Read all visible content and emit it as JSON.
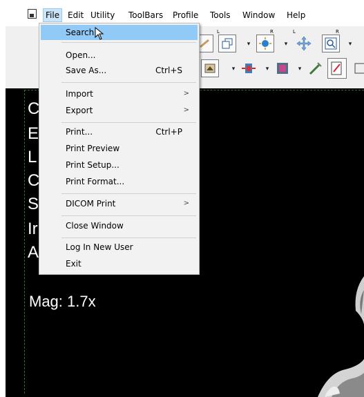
{
  "menubar": {
    "items": [
      {
        "label": "File"
      },
      {
        "label": "Edit"
      },
      {
        "label": "Utility"
      },
      {
        "label": "ToolBars"
      },
      {
        "label": "Profile"
      },
      {
        "label": "Tools"
      },
      {
        "label": "Window"
      },
      {
        "label": "Help"
      }
    ]
  },
  "file_menu": {
    "items": [
      {
        "label": "Search",
        "shortcut": "",
        "submenu": false
      },
      {
        "label": "Open...",
        "shortcut": "",
        "submenu": false
      },
      {
        "label": "Save As...",
        "shortcut": "Ctrl+S",
        "submenu": false
      },
      {
        "label": "Import",
        "shortcut": "",
        "submenu": true
      },
      {
        "label": "Export",
        "shortcut": "",
        "submenu": true
      },
      {
        "label": "Print...",
        "shortcut": "Ctrl+P",
        "submenu": false
      },
      {
        "label": "Print Preview",
        "shortcut": "",
        "submenu": false
      },
      {
        "label": "Print Setup...",
        "shortcut": "",
        "submenu": false
      },
      {
        "label": "Print Format...",
        "shortcut": "",
        "submenu": false
      },
      {
        "label": "DICOM Print",
        "shortcut": "",
        "submenu": true
      },
      {
        "label": "Close Window",
        "shortcut": "",
        "submenu": false
      },
      {
        "label": "Log In New User",
        "shortcut": "",
        "submenu": false
      },
      {
        "label": "Exit",
        "shortcut": "",
        "submenu": false
      }
    ],
    "submenu_arrow": ">"
  },
  "toolbar": {
    "corner_L": "L",
    "corner_R": "R",
    "dropdown_arrow": "▾"
  },
  "viewer": {
    "overlay_letters": [
      "C",
      "E",
      "L",
      "C",
      "S",
      "Ir",
      "A"
    ],
    "magnification": "Mag: 1.7x"
  },
  "colors": {
    "menu_hover": "#91c9f7",
    "menubar_active": "#cce4f7",
    "viewport_border": "#2b7a2b"
  }
}
